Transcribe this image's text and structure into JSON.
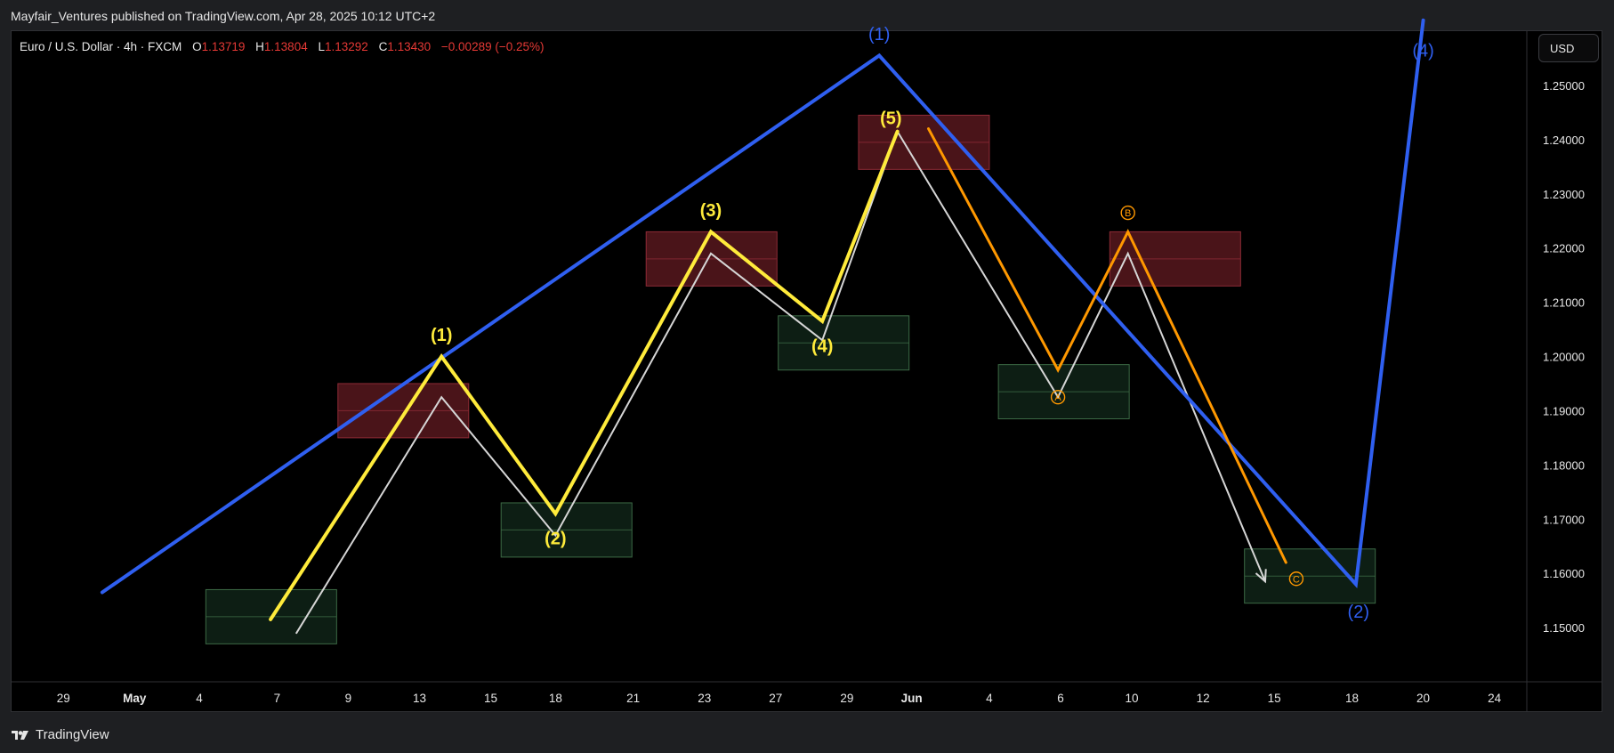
{
  "header": {
    "publisher_line": "Mayfair_Ventures published on TradingView.com, Apr 28, 2025 10:12 UTC+2"
  },
  "legend": {
    "symbol": "Euro / U.S. Dollar · 4h · FXCM",
    "o_label": "O",
    "o_value": "1.13719",
    "h_label": "H",
    "h_value": "1.13804",
    "l_label": "L",
    "l_value": "1.13292",
    "c_label": "C",
    "c_value": "1.13430",
    "change": "−0.00289 (−0.25%)"
  },
  "currency_button": "USD",
  "footer": {
    "brand": "TradingView"
  },
  "colors": {
    "background": "#000000",
    "grid_text": "#e6e6e6",
    "degree_blue": "#2f5ff0",
    "impulse_yellow": "#ffeb3b",
    "correction_orange": "#ff9800",
    "projection_white": "#d6d6d6",
    "supply_zone": "#4a1419",
    "demand_zone": "#0d1e14",
    "down_red": "#e53935"
  },
  "chart_data": {
    "type": "line",
    "title": "",
    "y_axis": {
      "side": "right",
      "range": [
        1.14,
        1.26
      ],
      "ticks": [
        "1.25000",
        "1.24000",
        "1.23000",
        "1.22000",
        "1.21000",
        "1.20000",
        "1.19000",
        "1.18000",
        "1.17000",
        "1.16000",
        "1.15000"
      ]
    },
    "x_axis": {
      "range": [
        -2.0,
        56.5
      ],
      "ticks": [
        {
          "label": "29",
          "x": 0
        },
        {
          "label": "May",
          "x": 2.75
        },
        {
          "label": "4",
          "x": 5.25
        },
        {
          "label": "7",
          "x": 8.25
        },
        {
          "label": "9",
          "x": 11
        },
        {
          "label": "13",
          "x": 13.75
        },
        {
          "label": "15",
          "x": 16.5
        },
        {
          "label": "18",
          "x": 19
        },
        {
          "label": "21",
          "x": 22
        },
        {
          "label": "23",
          "x": 24.75
        },
        {
          "label": "27",
          "x": 27.5
        },
        {
          "label": "29",
          "x": 30.25
        },
        {
          "label": "Jun",
          "x": 32.75
        },
        {
          "label": "4",
          "x": 35.75
        },
        {
          "label": "6",
          "x": 38.5
        },
        {
          "label": "10",
          "x": 41.25
        },
        {
          "label": "12",
          "x": 44
        },
        {
          "label": "15",
          "x": 46.75
        },
        {
          "label": "18",
          "x": 49.75
        },
        {
          "label": "20",
          "x": 52.5
        },
        {
          "label": "24",
          "x": 55.25
        }
      ]
    },
    "grid": false,
    "series": [
      {
        "role": "higher-degree",
        "style": "blue",
        "points": [
          [
            1.5,
            1.1565
          ],
          [
            31.5,
            1.2555
          ],
          [
            49.9,
            1.158
          ],
          [
            52.5,
            1.262
          ]
        ]
      },
      {
        "role": "impulse",
        "style": "yellow",
        "points": [
          [
            8,
            1.1515
          ],
          [
            14.6,
            1.2
          ],
          [
            19,
            1.171
          ],
          [
            25,
            1.223
          ],
          [
            29.3,
            1.2065
          ],
          [
            32.2,
            1.2415
          ]
        ]
      },
      {
        "role": "correction",
        "style": "orange",
        "points": [
          [
            33.4,
            1.242
          ],
          [
            38.4,
            1.1975
          ],
          [
            41.1,
            1.223
          ],
          [
            47.2,
            1.162
          ]
        ]
      },
      {
        "role": "projection",
        "style": "white",
        "points": [
          [
            9,
            1.149
          ],
          [
            14.6,
            1.1925
          ],
          [
            19,
            1.167
          ],
          [
            25,
            1.219
          ],
          [
            29.3,
            1.203
          ],
          [
            32.2,
            1.2415
          ],
          [
            38.4,
            1.1925
          ],
          [
            41.1,
            1.219
          ],
          [
            46.4,
            1.1585
          ]
        ]
      }
    ],
    "zones": [
      {
        "kind": "demand",
        "x0": 5.5,
        "x1": 10.55,
        "y0": 1.147,
        "y1": 1.157
      },
      {
        "kind": "supply",
        "x0": 10.6,
        "x1": 15.65,
        "y0": 1.185,
        "y1": 1.195
      },
      {
        "kind": "demand",
        "x0": 16.9,
        "x1": 21.95,
        "y0": 1.163,
        "y1": 1.173
      },
      {
        "kind": "supply",
        "x0": 22.5,
        "x1": 27.55,
        "y0": 1.213,
        "y1": 1.223
      },
      {
        "kind": "demand",
        "x0": 27.6,
        "x1": 32.65,
        "y0": 1.1975,
        "y1": 1.2075
      },
      {
        "kind": "supply",
        "x0": 30.7,
        "x1": 35.75,
        "y0": 1.2345,
        "y1": 1.2445
      },
      {
        "kind": "demand",
        "x0": 36.1,
        "x1": 41.15,
        "y0": 1.1885,
        "y1": 1.1985
      },
      {
        "kind": "supply",
        "x0": 40.4,
        "x1": 45.45,
        "y0": 1.213,
        "y1": 1.223
      },
      {
        "kind": "demand",
        "x0": 45.6,
        "x1": 50.65,
        "y0": 1.1545,
        "y1": 1.1645
      }
    ],
    "annotations": [
      {
        "text": "(1)",
        "x": 31.5,
        "y": 1.2595,
        "style": "blue"
      },
      {
        "text": "(2)",
        "x": 50.0,
        "y": 1.153,
        "style": "blue"
      },
      {
        "text": "(4)",
        "x": 52.5,
        "y": 1.2565,
        "style": "blue"
      },
      {
        "text": "(1)",
        "x": 14.6,
        "y": 1.204,
        "style": "yellow"
      },
      {
        "text": "(2)",
        "x": 19.0,
        "y": 1.1665,
        "style": "yellow"
      },
      {
        "text": "(3)",
        "x": 25.0,
        "y": 1.227,
        "style": "yellow"
      },
      {
        "text": "(4)",
        "x": 29.3,
        "y": 1.202,
        "style": "yellow"
      },
      {
        "text": "(5)",
        "x": 31.95,
        "y": 1.244,
        "style": "yellow"
      },
      {
        "text": "A",
        "x": 38.4,
        "y": 1.1925,
        "style": "orange-circle"
      },
      {
        "text": "B",
        "x": 41.1,
        "y": 1.2265,
        "style": "orange-circle"
      },
      {
        "text": "C",
        "x": 47.6,
        "y": 1.159,
        "style": "orange-circle"
      }
    ]
  }
}
